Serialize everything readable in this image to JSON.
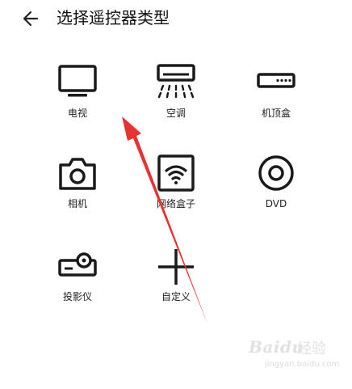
{
  "header": {
    "back_icon": "arrow-left-icon",
    "title": "选择遥控器类型"
  },
  "devices": [
    {
      "label": "电视",
      "icon": "tv-icon"
    },
    {
      "label": "空调",
      "icon": "air-conditioner-icon"
    },
    {
      "label": "机顶盒",
      "icon": "set-top-box-icon"
    },
    {
      "label": "相机",
      "icon": "camera-icon"
    },
    {
      "label": "网络盒子",
      "icon": "wifi-box-icon"
    },
    {
      "label": "DVD",
      "icon": "disc-icon"
    },
    {
      "label": "投影仪",
      "icon": "projector-icon"
    },
    {
      "label": "自定义",
      "icon": "plus-icon"
    }
  ],
  "annotation": {
    "arrow_color": "#e8322f"
  },
  "watermark": {
    "brand": "Baidu",
    "brand_cn": "经验",
    "url": "jingyan.baidu.com"
  }
}
